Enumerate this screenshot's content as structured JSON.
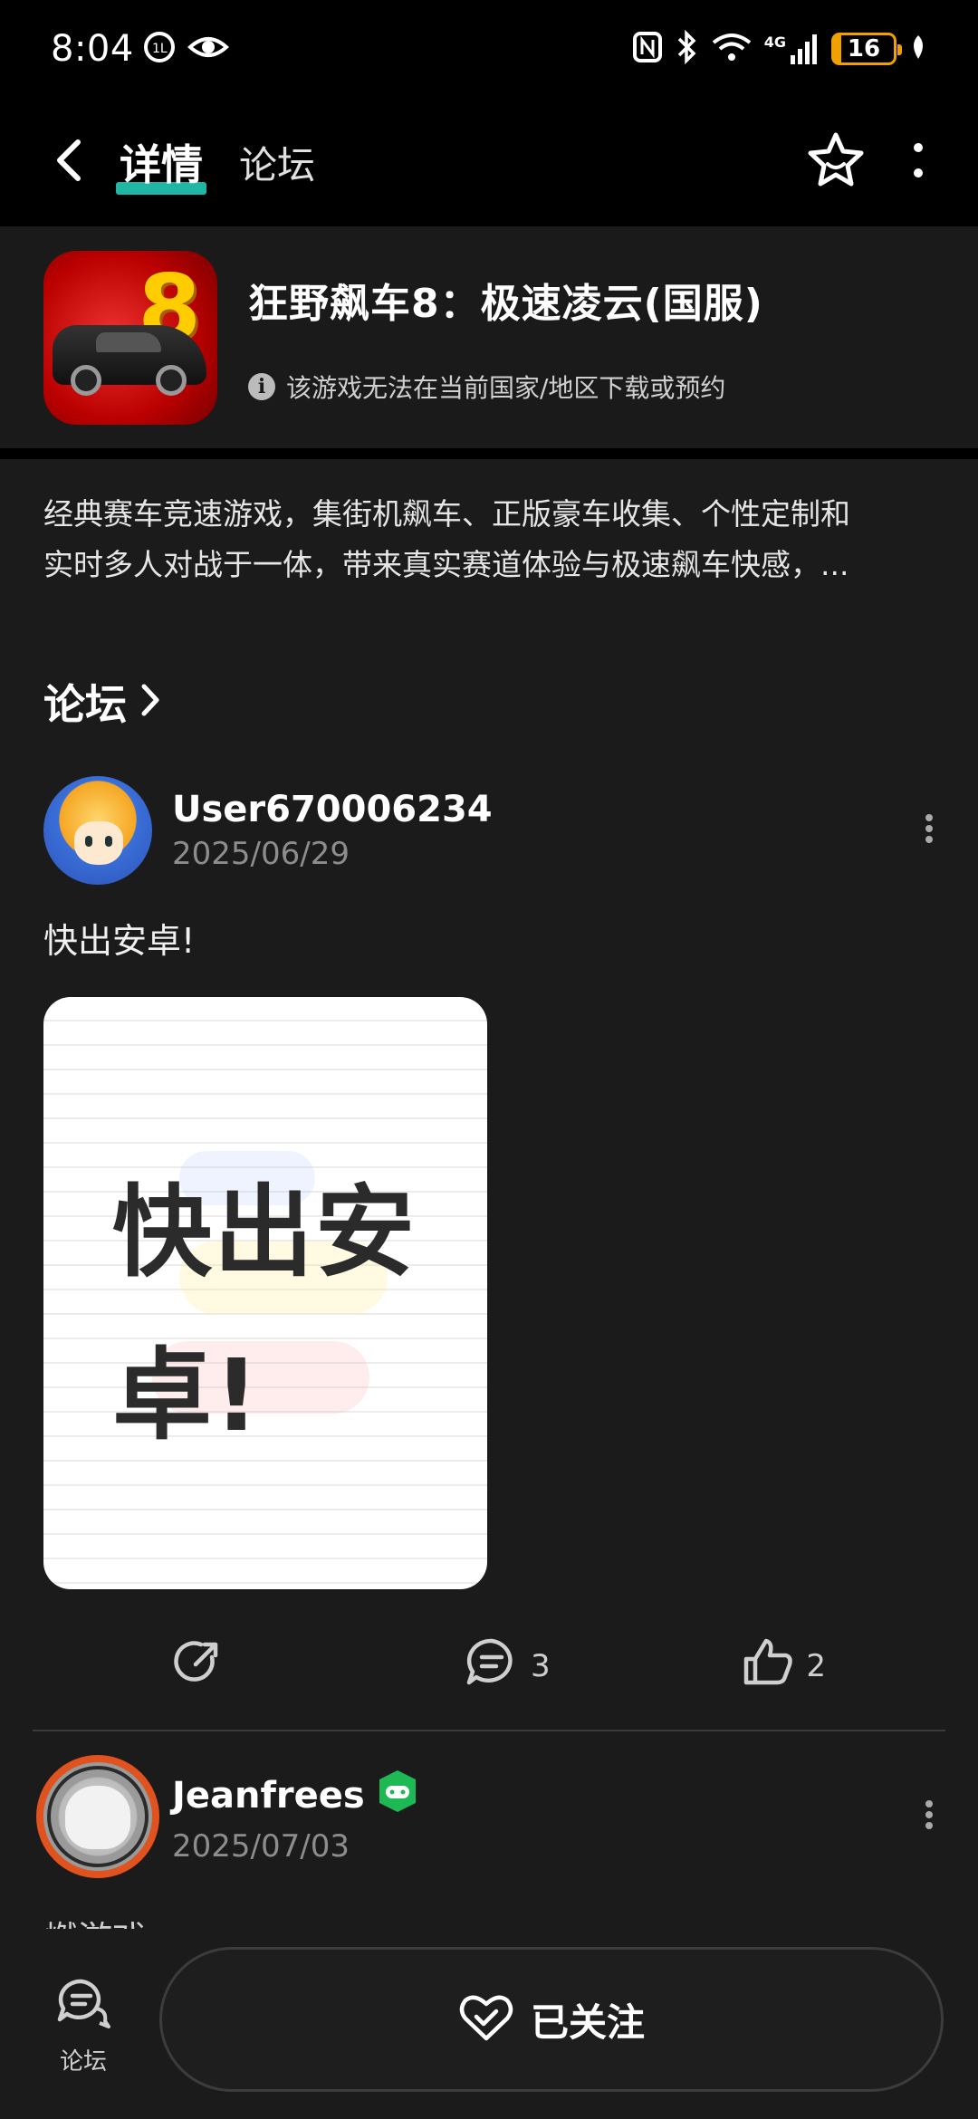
{
  "status_bar": {
    "time": "8:04",
    "network": "4G",
    "battery": "16"
  },
  "nav": {
    "tabs": [
      {
        "label": "详情",
        "active": true
      },
      {
        "label": "论坛",
        "active": false
      }
    ]
  },
  "game": {
    "icon_text": "8",
    "title": "狂野飙车8：极速凌云(国服)",
    "notice": "该游戏无法在当前国家/地区下载或预约"
  },
  "description": {
    "line1": "经典赛车竞速游戏，集街机飙车、正版豪车收集、个性定制和",
    "line2": "实时多人对战于一体，带来真实赛道体验与极速飙车快感，..."
  },
  "forum": {
    "heading": "论坛",
    "posts": [
      {
        "user": "User670006234",
        "date": "2025/06/29",
        "text": "快出安卓!",
        "image_text": "快出安卓!",
        "comments": "3",
        "likes": "2"
      },
      {
        "user": "Jeanfrees",
        "date": "2025/07/03",
        "text_partial": "燃游戏"
      }
    ]
  },
  "bottom_bar": {
    "forum_label": "论坛",
    "follow_label": "已关注"
  },
  "colors": {
    "accent": "#1fb6a5",
    "background": "#1b1b1b",
    "battery": "#f0a000",
    "badge_green": "#1db954"
  }
}
